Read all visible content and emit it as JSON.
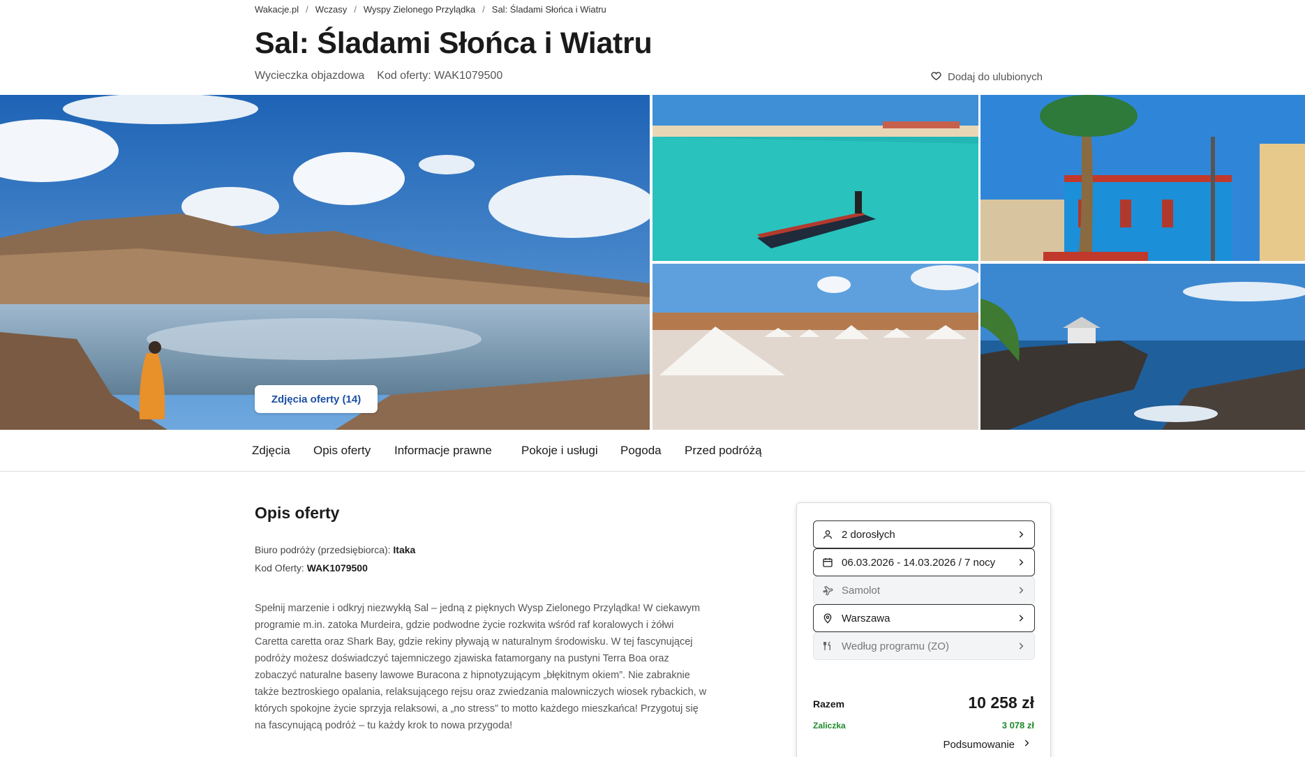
{
  "breadcrumb": [
    "Wakacje.pl",
    "Wczasy",
    "Wyspy Zielonego Przylądka",
    "Sal: Śladami Słońca i Wiatru"
  ],
  "title": "Sal: Śladami Słońca i Wiatru",
  "meta": {
    "type": "Wycieczka objazdowa",
    "code": "Kod oferty: WAK1079500"
  },
  "favorite": {
    "label": "Dodaj do ulubionych",
    "icon": "heart-icon"
  },
  "gallery": {
    "button_label": "Zdjęcia oferty (14)"
  },
  "tabs": [
    "Zdjęcia",
    "Opis oferty",
    "Informacje prawne",
    "Pokoje i usługi",
    "Pogoda",
    "Przed podróżą"
  ],
  "description": {
    "title": "Opis oferty",
    "operator_label": "Biuro podróży (przedsiębiorca):",
    "operator_value": "Itaka",
    "code_label": "Kod Oferty:",
    "code_value": "WAK1079500",
    "body": "Spełnij marzenie i odkryj niezwykłą Sal – jedną z pięknych Wysp Zielonego Przylądka! W ciekawym programie m.in. zatoka Murdeira, gdzie podwodne życie rozkwita wśród raf koralowych i żółwi Caretta caretta oraz Shark Bay, gdzie rekiny pływają w naturalnym środowisku. W tej fascynującej podróży możesz doświadczyć tajemniczego zjawiska fatamorgany na pustyni Terra Boa oraz zobaczyć naturalne baseny lawowe Buracona z hipnotyzującym „błękitnym okiem”. Nie zabraknie także beztroskiego opalania, relaksującego rejsu oraz zwiedzania malowniczych wiosek rybackich, w których spokojne życie sprzyja relaksowi, a „no stress” to motto każdego mieszkańca! Przygotuj się na fascynującą podróż – tu każdy krok to nowa przygoda!"
  },
  "booking": {
    "options": [
      {
        "label": "2 dorosłych",
        "icon": "person-icon",
        "disabled": false
      },
      {
        "label": "06.03.2026 - 14.03.2026 / 7 nocy",
        "icon": "calendar-icon",
        "disabled": false
      },
      {
        "label": "Samolot",
        "icon": "plane-icon",
        "disabled": true
      },
      {
        "label": "Warszawa",
        "icon": "location-pin-icon",
        "disabled": false
      },
      {
        "label": "Według programu (ZO)",
        "icon": "cutlery-icon",
        "disabled": true
      }
    ],
    "total_label": "Razem",
    "total_price": "10 258 zł",
    "deposit_label": "Zaliczka",
    "deposit_price": "3 078 zł",
    "summary_label": "Podsumowanie"
  },
  "colors": {
    "accent_blue": "#1b4fa3",
    "deposit_green": "#1f8a2b",
    "text": "#1a1a1a"
  }
}
